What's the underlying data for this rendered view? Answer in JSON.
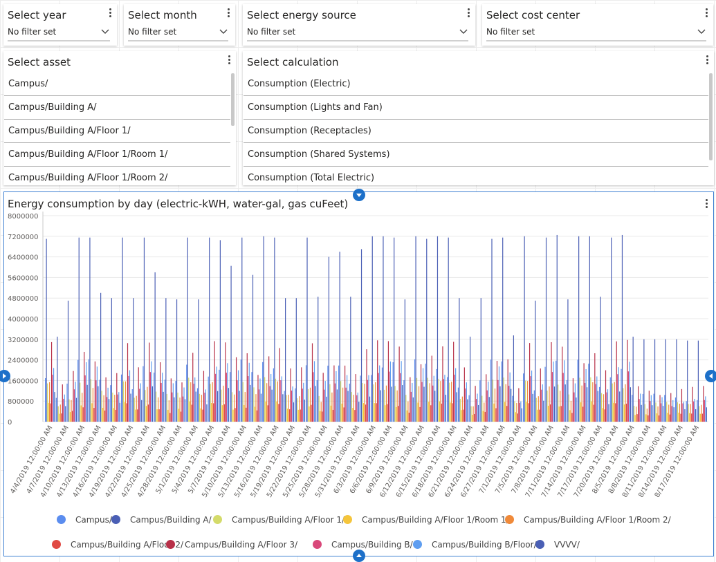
{
  "slicers": {
    "year": {
      "title": "Select year",
      "value": "No filter set"
    },
    "month": {
      "title": "Select month",
      "value": "No filter set"
    },
    "energy_source": {
      "title": "Select energy source",
      "value": "No filter set"
    },
    "cost_center": {
      "title": "Select cost center",
      "value": "No filter set"
    }
  },
  "asset_list": {
    "title": "Select asset",
    "items": [
      "Campus/",
      "Campus/Building A/",
      "Campus/Building A/Floor 1/",
      "Campus/Building A/Floor 1/Room 1/",
      "Campus/Building A/Floor 1/Room 2/"
    ]
  },
  "calculation_list": {
    "title": "Select calculation",
    "items": [
      "Consumption (Electric)",
      "Consumption (Lights and Fan)",
      "Consumption (Receptacles)",
      "Consumption (Shared Systems)",
      "Consumption (Total Electric)"
    ]
  },
  "chart_data": {
    "type": "bar",
    "title": "Energy consumption by day (electric-kWH, water-gal, gas cuFeet)",
    "xlabel": "",
    "ylabel": "",
    "ylim": [
      0,
      8000000
    ],
    "y_ticks": [
      "0",
      "800000",
      "1600000",
      "2400000",
      "3200000",
      "4000000",
      "4800000",
      "5600000",
      "6400000",
      "7200000",
      "8000000"
    ],
    "x_tick_labels": [
      "4/4/2019 12:00:00 AM",
      "4/7/2019 12:00:00 AM",
      "4/10/2019 12:00:00 AM",
      "4/13/2019 12:00:00 AM",
      "4/16/2019 12:00:00 AM",
      "4/19/2019 12:00:00 AM",
      "4/22/2019 12:00:00 AM",
      "4/25/2019 12:00:00 AM",
      "4/28/2019 12:00:00 AM",
      "5/1/2019 12:00:00 AM",
      "5/4/2019 12:00:00 AM",
      "5/7/2019 12:00:00 AM",
      "5/10/2019 12:00:00 AM",
      "5/13/2019 12:00:00 AM",
      "5/16/2019 12:00:00 AM",
      "5/19/2019 12:00:00 AM",
      "5/22/2019 12:00:00 AM",
      "5/25/2019 12:00:00 AM",
      "5/28/2019 12:00:00 AM",
      "5/31/2019 12:00:00 AM",
      "6/3/2019 12:00:00 AM",
      "6/6/2019 12:00:00 AM",
      "6/9/2019 12:00:00 AM",
      "6/12/2019 12:00:00 AM",
      "6/15/2019 12:00:00 AM",
      "6/18/2019 12:00:00 AM",
      "6/21/2019 12:00:00 AM",
      "6/24/2019 12:00:00 AM",
      "6/27/2019 12:00:00 AM",
      "7/1/2019 12:00:00 AM",
      "7/5/2019 12:00:00 AM",
      "7/8/2019 12:00:00 AM",
      "7/11/2019 12:00:00 AM",
      "7/14/2019 12:00:00 AM",
      "7/17/2019 12:00:00 AM",
      "7/20/2019 12:00:00 AM",
      "8/5/2019 12:00:00 AM",
      "8/8/2019 12:00:00 AM",
      "8/11/2019 12:00:00 AM",
      "8/14/2019 12:00:00 AM",
      "8/17/2019 12:00:00 AM"
    ],
    "series": [
      {
        "name": "Campus/",
        "color": "#5b8def"
      },
      {
        "name": "Campus/Building A/",
        "color": "#4a5fb5"
      },
      {
        "name": "Campus/Building A/Floor 1/",
        "color": "#d4db6a"
      },
      {
        "name": "Campus/Building A/Floor 1/Room 1/",
        "color": "#f5c53b"
      },
      {
        "name": "Campus/Building A/Floor 1/Room 2/",
        "color": "#f08a3a"
      },
      {
        "name": "Campus/Building A/Floor 2/",
        "color": "#e04a44"
      },
      {
        "name": "Campus/Building A/Floor 3/",
        "color": "#b83048"
      },
      {
        "name": "Campus/Building B/",
        "color": "#d9487a"
      },
      {
        "name": "Campus/Building B/Floor/",
        "color": "#5f9ef0"
      },
      {
        "name": "VVVV/",
        "color": "#4a5fb5"
      }
    ],
    "daily_peak_values": [
      7100000,
      3300000,
      4700000,
      7150000,
      7150000,
      5000000,
      4800000,
      7150000,
      4800000,
      7150000,
      5800000,
      4800000,
      4750000,
      7150000,
      4750000,
      7150000,
      7050000,
      6050000,
      7150000,
      5700000,
      7200000,
      7150000,
      4800000,
      4800000,
      7150000,
      4850000,
      6400000,
      6600000,
      4850000,
      6700000,
      7200000,
      7200000,
      7150000,
      4750000,
      7200000,
      7100000,
      7200000,
      7150000,
      4800000,
      3300000,
      4800000,
      7100000,
      7150000,
      3350000,
      7200000,
      4700000,
      7150000,
      7250000,
      4750000,
      7200000,
      7200000,
      4850000,
      7150000,
      7250000,
      3300000,
      3200000,
      3200000,
      3200000,
      3200000,
      3150000,
      3150000
    ]
  }
}
